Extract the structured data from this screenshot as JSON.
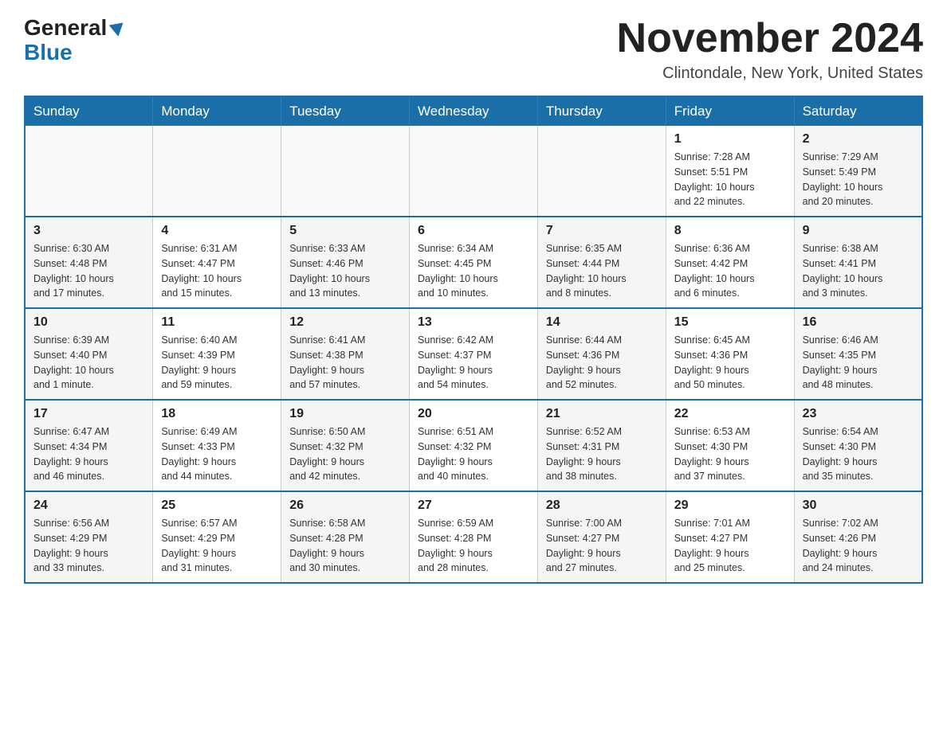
{
  "header": {
    "logo_general": "General",
    "logo_blue": "Blue",
    "month_title": "November 2024",
    "location": "Clintondale, New York, United States"
  },
  "weekdays": [
    "Sunday",
    "Monday",
    "Tuesday",
    "Wednesday",
    "Thursday",
    "Friday",
    "Saturday"
  ],
  "weeks": [
    [
      {
        "day": "",
        "info": ""
      },
      {
        "day": "",
        "info": ""
      },
      {
        "day": "",
        "info": ""
      },
      {
        "day": "",
        "info": ""
      },
      {
        "day": "",
        "info": ""
      },
      {
        "day": "1",
        "info": "Sunrise: 7:28 AM\nSunset: 5:51 PM\nDaylight: 10 hours\nand 22 minutes."
      },
      {
        "day": "2",
        "info": "Sunrise: 7:29 AM\nSunset: 5:49 PM\nDaylight: 10 hours\nand 20 minutes."
      }
    ],
    [
      {
        "day": "3",
        "info": "Sunrise: 6:30 AM\nSunset: 4:48 PM\nDaylight: 10 hours\nand 17 minutes."
      },
      {
        "day": "4",
        "info": "Sunrise: 6:31 AM\nSunset: 4:47 PM\nDaylight: 10 hours\nand 15 minutes."
      },
      {
        "day": "5",
        "info": "Sunrise: 6:33 AM\nSunset: 4:46 PM\nDaylight: 10 hours\nand 13 minutes."
      },
      {
        "day": "6",
        "info": "Sunrise: 6:34 AM\nSunset: 4:45 PM\nDaylight: 10 hours\nand 10 minutes."
      },
      {
        "day": "7",
        "info": "Sunrise: 6:35 AM\nSunset: 4:44 PM\nDaylight: 10 hours\nand 8 minutes."
      },
      {
        "day": "8",
        "info": "Sunrise: 6:36 AM\nSunset: 4:42 PM\nDaylight: 10 hours\nand 6 minutes."
      },
      {
        "day": "9",
        "info": "Sunrise: 6:38 AM\nSunset: 4:41 PM\nDaylight: 10 hours\nand 3 minutes."
      }
    ],
    [
      {
        "day": "10",
        "info": "Sunrise: 6:39 AM\nSunset: 4:40 PM\nDaylight: 10 hours\nand 1 minute."
      },
      {
        "day": "11",
        "info": "Sunrise: 6:40 AM\nSunset: 4:39 PM\nDaylight: 9 hours\nand 59 minutes."
      },
      {
        "day": "12",
        "info": "Sunrise: 6:41 AM\nSunset: 4:38 PM\nDaylight: 9 hours\nand 57 minutes."
      },
      {
        "day": "13",
        "info": "Sunrise: 6:42 AM\nSunset: 4:37 PM\nDaylight: 9 hours\nand 54 minutes."
      },
      {
        "day": "14",
        "info": "Sunrise: 6:44 AM\nSunset: 4:36 PM\nDaylight: 9 hours\nand 52 minutes."
      },
      {
        "day": "15",
        "info": "Sunrise: 6:45 AM\nSunset: 4:36 PM\nDaylight: 9 hours\nand 50 minutes."
      },
      {
        "day": "16",
        "info": "Sunrise: 6:46 AM\nSunset: 4:35 PM\nDaylight: 9 hours\nand 48 minutes."
      }
    ],
    [
      {
        "day": "17",
        "info": "Sunrise: 6:47 AM\nSunset: 4:34 PM\nDaylight: 9 hours\nand 46 minutes."
      },
      {
        "day": "18",
        "info": "Sunrise: 6:49 AM\nSunset: 4:33 PM\nDaylight: 9 hours\nand 44 minutes."
      },
      {
        "day": "19",
        "info": "Sunrise: 6:50 AM\nSunset: 4:32 PM\nDaylight: 9 hours\nand 42 minutes."
      },
      {
        "day": "20",
        "info": "Sunrise: 6:51 AM\nSunset: 4:32 PM\nDaylight: 9 hours\nand 40 minutes."
      },
      {
        "day": "21",
        "info": "Sunrise: 6:52 AM\nSunset: 4:31 PM\nDaylight: 9 hours\nand 38 minutes."
      },
      {
        "day": "22",
        "info": "Sunrise: 6:53 AM\nSunset: 4:30 PM\nDaylight: 9 hours\nand 37 minutes."
      },
      {
        "day": "23",
        "info": "Sunrise: 6:54 AM\nSunset: 4:30 PM\nDaylight: 9 hours\nand 35 minutes."
      }
    ],
    [
      {
        "day": "24",
        "info": "Sunrise: 6:56 AM\nSunset: 4:29 PM\nDaylight: 9 hours\nand 33 minutes."
      },
      {
        "day": "25",
        "info": "Sunrise: 6:57 AM\nSunset: 4:29 PM\nDaylight: 9 hours\nand 31 minutes."
      },
      {
        "day": "26",
        "info": "Sunrise: 6:58 AM\nSunset: 4:28 PM\nDaylight: 9 hours\nand 30 minutes."
      },
      {
        "day": "27",
        "info": "Sunrise: 6:59 AM\nSunset: 4:28 PM\nDaylight: 9 hours\nand 28 minutes."
      },
      {
        "day": "28",
        "info": "Sunrise: 7:00 AM\nSunset: 4:27 PM\nDaylight: 9 hours\nand 27 minutes."
      },
      {
        "day": "29",
        "info": "Sunrise: 7:01 AM\nSunset: 4:27 PM\nDaylight: 9 hours\nand 25 minutes."
      },
      {
        "day": "30",
        "info": "Sunrise: 7:02 AM\nSunset: 4:26 PM\nDaylight: 9 hours\nand 24 minutes."
      }
    ]
  ]
}
